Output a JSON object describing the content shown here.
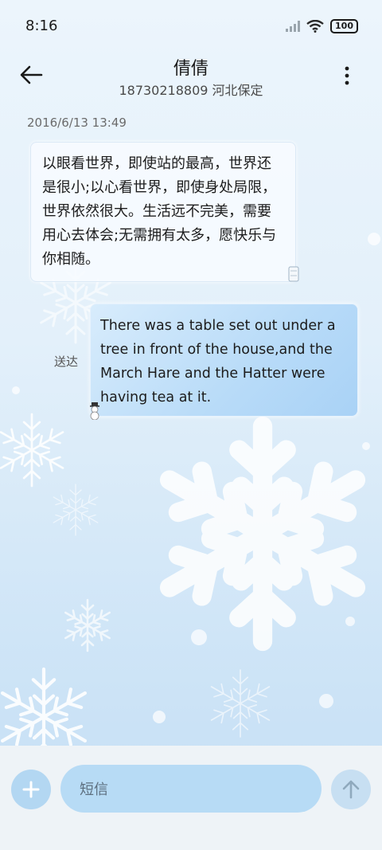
{
  "status_bar": {
    "time": "8:16",
    "battery": "100"
  },
  "header": {
    "back_icon": "arrow-left-icon",
    "title": "倩倩",
    "subtitle": "18730218809 河北保定",
    "more_icon": "more-vertical-icon"
  },
  "conversation": {
    "timestamp": "2016/6/13 13:49",
    "messages": [
      {
        "direction": "incoming",
        "text": "以眼看世界，即使站的最高，世界还是很小;以心看世界，即使身处局限，世界依然很大。生活远不完美，需要用心去体会;无需拥有太多，愿快乐与你相随。"
      },
      {
        "direction": "outgoing",
        "text": "There was a table set out under a tree in front of the house,and the March Hare and the Hatter were having tea at it.",
        "status": "送达"
      }
    ]
  },
  "composer": {
    "placeholder": "短信",
    "add_icon": "plus-icon",
    "send_icon": "arrow-up-icon"
  },
  "colors": {
    "accent": "#b3d7f2",
    "input_bg": "#b7dbf5",
    "outgoing_bubble": "#b8dbf8"
  }
}
